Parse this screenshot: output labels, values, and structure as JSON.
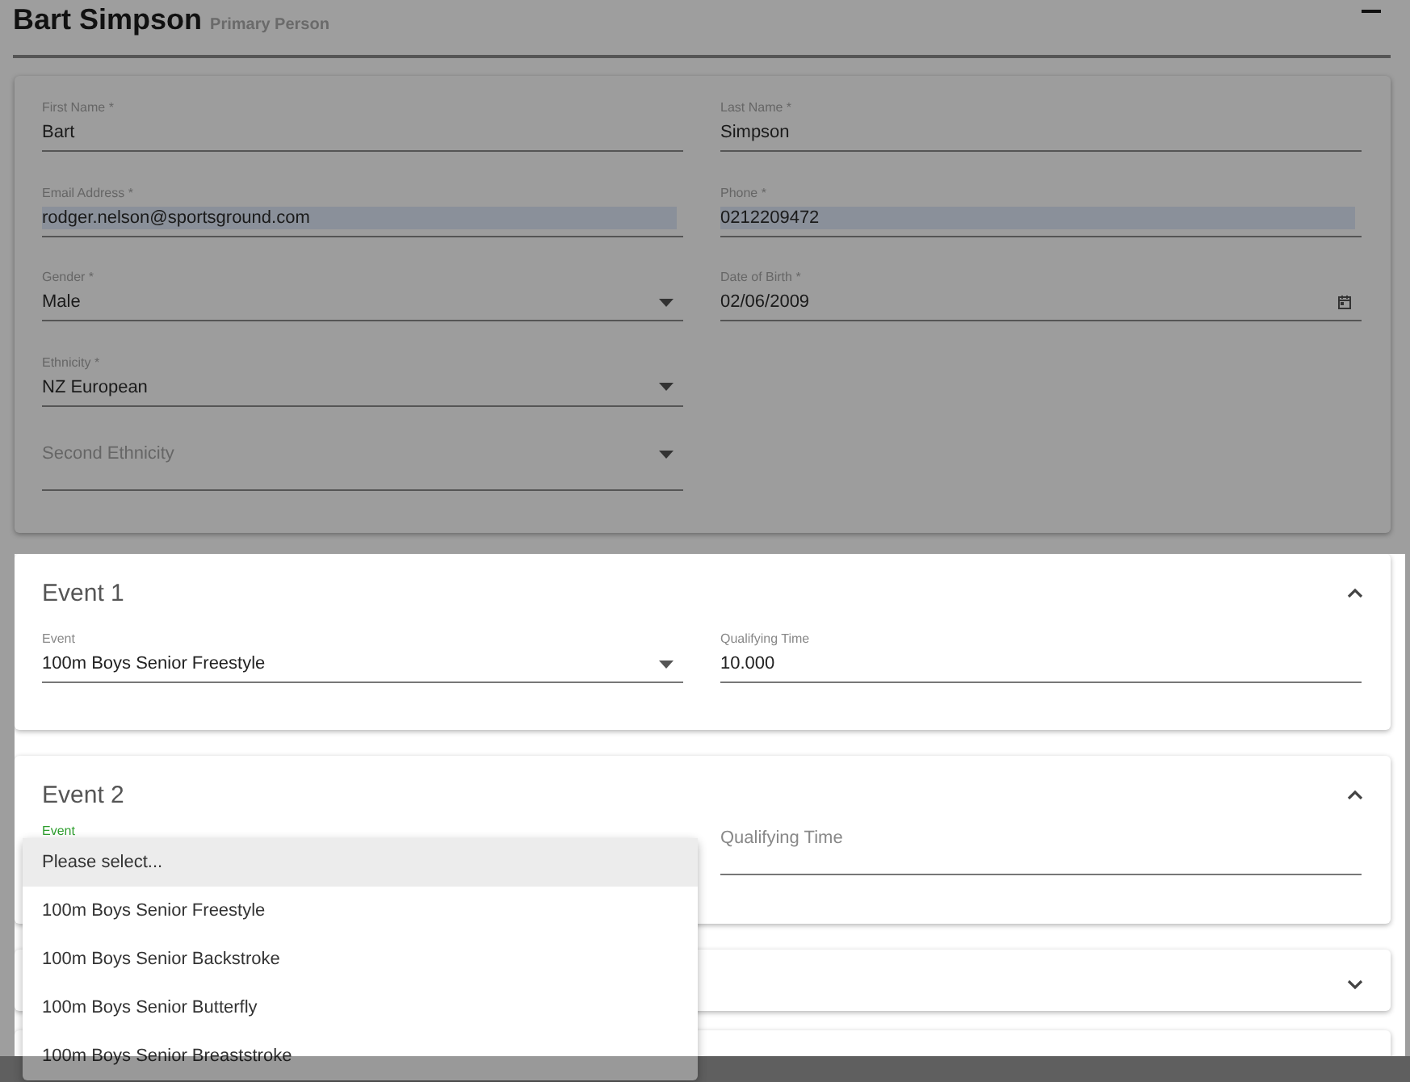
{
  "header": {
    "name": "Bart Simpson",
    "role": "Primary Person"
  },
  "person_rows": [
    [
      {
        "label": "First Name *",
        "value": "Bart",
        "kind": "text",
        "autofilled": false
      },
      {
        "label": "Last Name *",
        "value": "Simpson",
        "kind": "text",
        "autofilled": false
      }
    ],
    [
      {
        "label": "Email Address *",
        "value": "rodger.nelson@sportsground.com",
        "kind": "text",
        "autofilled": true
      },
      {
        "label": "Phone *",
        "value": "0212209472",
        "kind": "text",
        "autofilled": true
      }
    ],
    [
      {
        "label": "Gender *",
        "value": "Male",
        "kind": "select",
        "autofilled": false
      },
      {
        "label": "Date of Birth *",
        "value": "02/06/2009",
        "kind": "date",
        "autofilled": false
      }
    ],
    [
      {
        "label": "Ethnicity *",
        "value": "NZ European",
        "kind": "select",
        "autofilled": false
      }
    ],
    [
      {
        "placeholder": "Second Ethnicity",
        "kind": "select",
        "autofilled": false
      }
    ]
  ],
  "events": [
    {
      "title": "Event 1",
      "expanded": true,
      "fields": [
        {
          "label": "Event",
          "value": "100m Boys Senior Freestyle",
          "kind": "select",
          "focused": false
        },
        {
          "label": "Qualifying Time",
          "value": "10.000",
          "kind": "text",
          "focused": false
        }
      ]
    },
    {
      "title": "Event 2",
      "expanded": true,
      "fields": [
        {
          "label": "Event",
          "kind": "select",
          "focused": true
        },
        {
          "placeholder": "Qualifying Time",
          "kind": "text",
          "focused": false
        }
      ]
    },
    {
      "expanded": false
    }
  ],
  "dropdown": {
    "options": [
      {
        "label": "Please select...",
        "selected": true
      },
      {
        "label": "100m Boys Senior Freestyle",
        "selected": false
      },
      {
        "label": "100m Boys Senior Backstroke",
        "selected": false
      },
      {
        "label": "100m Boys Senior Butterfly",
        "selected": false
      },
      {
        "label": "100m Boys Senior Breaststroke",
        "selected": false
      }
    ]
  }
}
